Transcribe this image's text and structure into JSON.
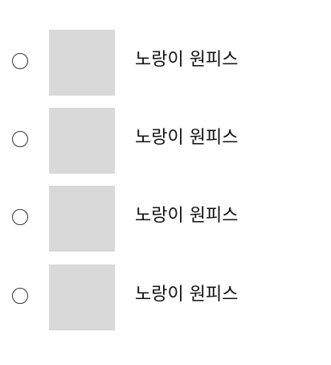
{
  "options": [
    {
      "label": "노랑이 원피스",
      "selected": false,
      "icon": "radio-unchecked-icon"
    },
    {
      "label": "노랑이 원피스",
      "selected": false,
      "icon": "radio-unchecked-icon"
    },
    {
      "label": "노랑이 원피스",
      "selected": false,
      "icon": "radio-unchecked-icon"
    },
    {
      "label": "노랑이 원피스",
      "selected": false,
      "icon": "radio-unchecked-icon"
    }
  ],
  "colors": {
    "thumbnail_placeholder": "#d9d9d9",
    "radio_border": "#333333",
    "text": "#111111"
  }
}
